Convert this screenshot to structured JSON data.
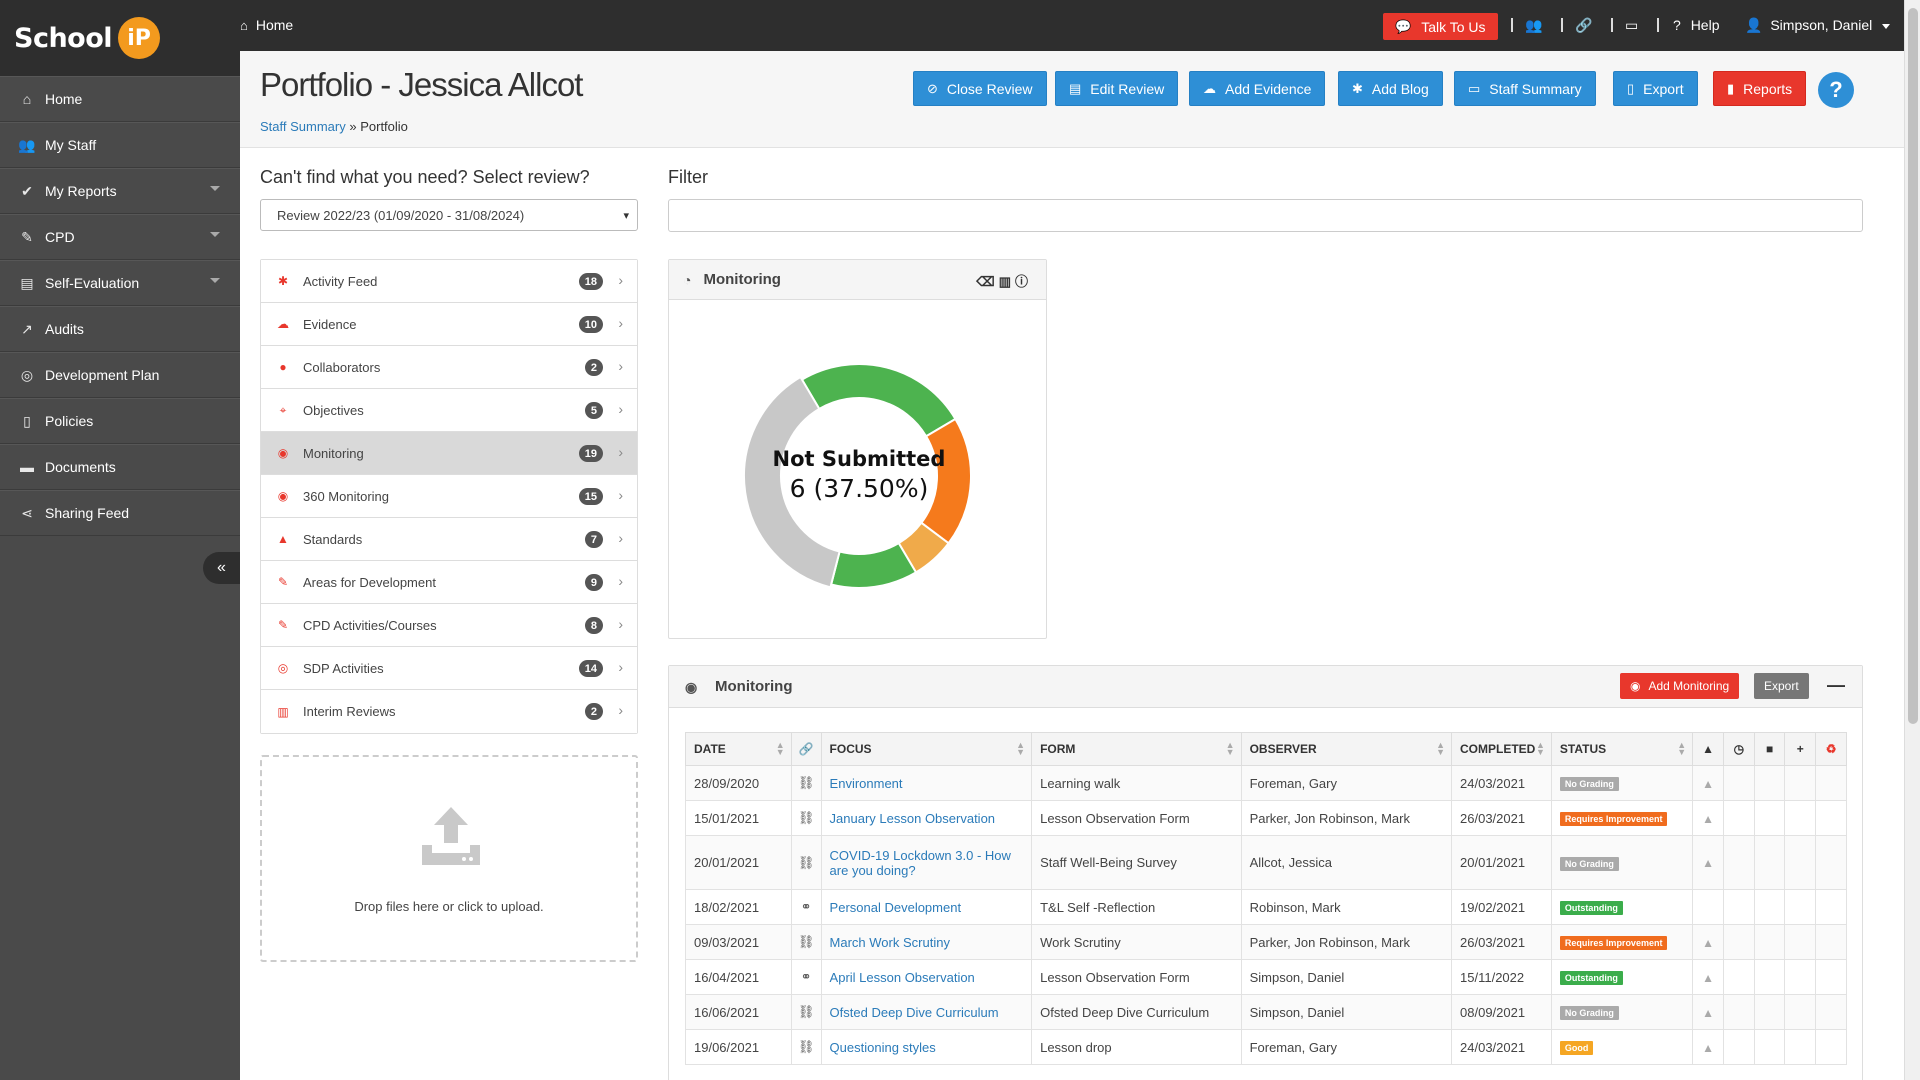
{
  "app": {
    "logo_text": "School",
    "logo_badge": "iP"
  },
  "sidebar": {
    "items": [
      {
        "label": "Home",
        "icon": "home-icon",
        "glyph": "⌂",
        "has_caret": false
      },
      {
        "label": "My Staff",
        "icon": "users-icon",
        "glyph": "👥",
        "has_caret": false
      },
      {
        "label": "My Reports",
        "icon": "check-icon",
        "glyph": "✔",
        "has_caret": true
      },
      {
        "label": "CPD",
        "icon": "tag-icon",
        "glyph": "✎",
        "has_caret": true
      },
      {
        "label": "Self-Evaluation",
        "icon": "book-icon",
        "glyph": "▤",
        "has_caret": true
      },
      {
        "label": "Audits",
        "icon": "line-chart-icon",
        "glyph": "↗",
        "has_caret": false
      },
      {
        "label": "Development Plan",
        "icon": "target-icon",
        "glyph": "◎",
        "has_caret": false
      },
      {
        "label": "Policies",
        "icon": "file-icon",
        "glyph": "▯",
        "has_caret": false
      },
      {
        "label": "Documents",
        "icon": "folder-icon",
        "glyph": "▬",
        "has_caret": false
      },
      {
        "label": "Sharing Feed",
        "icon": "share-icon",
        "glyph": "⋖",
        "has_caret": false
      }
    ],
    "collapse_glyph": "«"
  },
  "topbar": {
    "home_label": "Home",
    "talk_label": "Talk To Us",
    "help_label": "Help",
    "user_label": "Simpson, Daniel"
  },
  "header": {
    "title": "Portfolio - Jessica Allcot",
    "breadcrumb_link": "Staff Summary",
    "breadcrumb_sep": "»",
    "breadcrumb_current": "Portfolio",
    "buttons": {
      "close_review": "Close Review",
      "edit_review": "Edit Review",
      "add_evidence": "Add Evidence",
      "add_blog": "Add Blog",
      "staff_summary": "Staff Summary",
      "export": "Export",
      "reports": "Reports"
    },
    "help_glyph": "?"
  },
  "review": {
    "label": "Can't find what you need? Select review?",
    "selected": "Review 2022/23 (01/09/2020 - 31/08/2024)"
  },
  "filter": {
    "label": "Filter",
    "value": ""
  },
  "portfolio_items": [
    {
      "label": "Activity Feed",
      "count": "18",
      "glyph": "✱"
    },
    {
      "label": "Evidence",
      "count": "10",
      "glyph": "☁"
    },
    {
      "label": "Collaborators",
      "count": "2",
      "glyph": "●"
    },
    {
      "label": "Objectives",
      "count": "5",
      "glyph": "⌖"
    },
    {
      "label": "Monitoring",
      "count": "19",
      "glyph": "◉",
      "active": true
    },
    {
      "label": "360 Monitoring",
      "count": "15",
      "glyph": "◉"
    },
    {
      "label": "Standards",
      "count": "7",
      "glyph": "▲"
    },
    {
      "label": "Areas for Development",
      "count": "9",
      "glyph": "✎"
    },
    {
      "label": "CPD Activities/Courses",
      "count": "8",
      "glyph": "✎"
    },
    {
      "label": "SDP Activities",
      "count": "14",
      "glyph": "◎"
    },
    {
      "label": "Interim Reviews",
      "count": "2",
      "glyph": "▥"
    }
  ],
  "dropzone": {
    "text": "Drop files here or click to upload."
  },
  "monitoring_chart": {
    "title": "Monitoring",
    "center_label": "Not Submitted",
    "center_value": "6 (37.50%)"
  },
  "chart_data": {
    "type": "pie",
    "title": "",
    "slices": [
      {
        "label": "",
        "value": 4,
        "color": "#4db34f"
      },
      {
        "label": "",
        "value": 3,
        "color": "#f57a1c"
      },
      {
        "label": "",
        "value": 1,
        "color": "#f0aa4a"
      },
      {
        "label": "",
        "value": 2,
        "color": "#4db34f"
      },
      {
        "label": "Not Submitted",
        "value": 6,
        "color": "#c8c8c8"
      }
    ],
    "highlighted": "Not Submitted"
  },
  "monitoring_table": {
    "title": "Monitoring",
    "add_label": "Add Monitoring",
    "export_label": "Export",
    "columns": [
      "DATE",
      "FOCUS",
      "FORM",
      "OBSERVER",
      "COMPLETED",
      "STATUS"
    ],
    "rows": [
      {
        "date": "28/09/2020",
        "focus": "Environment",
        "form": "Learning walk",
        "observer": "Foreman, Gary",
        "completed": "24/03/2021",
        "status": "No Grading",
        "status_class": "st-gray",
        "linked": false,
        "chart": true
      },
      {
        "date": "15/01/2021",
        "focus": "January Lesson Observation",
        "form": "Lesson Observation Form",
        "observer": "Parker, Jon Robinson, Mark",
        "completed": "26/03/2021",
        "status": "Requires Improvement",
        "status_class": "st-orange",
        "linked": false,
        "chart": true
      },
      {
        "date": "20/01/2021",
        "focus": "COVID-19 Lockdown 3.0 - How are you doing?",
        "form": "Staff Well-Being Survey",
        "observer": "Allcot, Jessica",
        "completed": "20/01/2021",
        "status": "No Grading",
        "status_class": "st-gray",
        "linked": false,
        "chart": true,
        "tall": true
      },
      {
        "date": "18/02/2021",
        "focus": "Personal Development",
        "form": "T&L Self -Reflection",
        "observer": "Robinson, Mark",
        "completed": "19/02/2021",
        "status": "Outstanding",
        "status_class": "st-green",
        "linked": true,
        "chart": false
      },
      {
        "date": "09/03/2021",
        "focus": "March Work Scrutiny",
        "form": "Work Scrutiny",
        "observer": "Parker, Jon Robinson, Mark",
        "completed": "26/03/2021",
        "status": "Requires Improvement",
        "status_class": "st-orange",
        "linked": false,
        "chart": true
      },
      {
        "date": "16/04/2021",
        "focus": "April Lesson Observation",
        "form": "Lesson Observation Form",
        "observer": "Simpson, Daniel",
        "completed": "15/11/2022",
        "status": "Outstanding",
        "status_class": "st-green",
        "linked": true,
        "chart": true
      },
      {
        "date": "16/06/2021",
        "focus": "Ofsted Deep Dive Curriculum",
        "form": "Ofsted Deep Dive Curriculum",
        "observer": "Simpson, Daniel",
        "completed": "08/09/2021",
        "status": "No Grading",
        "status_class": "st-gray",
        "linked": false,
        "chart": true
      },
      {
        "date": "19/06/2021",
        "focus": "Questioning styles",
        "form": "Lesson drop",
        "observer": "Foreman, Gary",
        "completed": "24/03/2021",
        "status": "Good",
        "status_class": "st-amber",
        "linked": false,
        "chart": true
      }
    ]
  }
}
